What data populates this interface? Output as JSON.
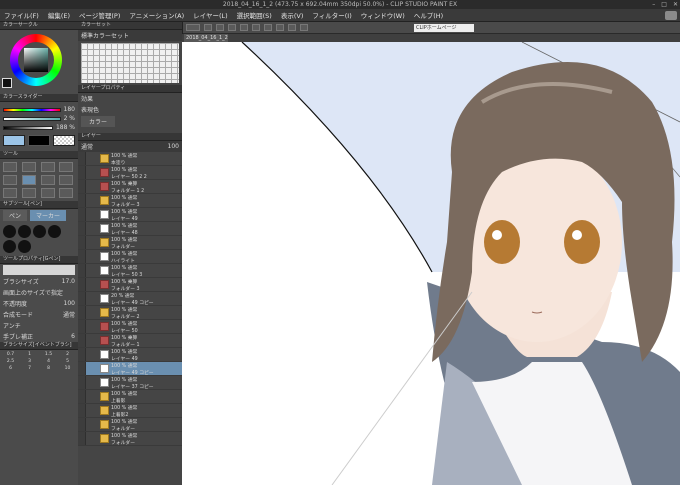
{
  "window": {
    "title": "2018_04_16_1_2 (473.75 x 692.04mm 350dpi 50.0%) - CLIP STUDIO PAINT EX"
  },
  "menu": [
    "ファイル(F)",
    "編集(E)",
    "ページ管理(P)",
    "アニメーション(A)",
    "レイヤー(L)",
    "選択範囲(S)",
    "表示(V)",
    "フィルター(I)",
    "ウィンドウ(W)",
    "ヘルプ(H)"
  ],
  "toolbar": {
    "url_label": "CLIPホームページ"
  },
  "panels": {
    "color_circle": "カラーサークル",
    "color_set": "カラーセット",
    "color_set_name": "標準カラーセット",
    "layer_property": "レイヤープロパティ",
    "effect": "効果",
    "expression_color": "表現色",
    "color_mode": "カラー",
    "color_slider": "カラースライダー",
    "slider_values": [
      "180",
      "2 %",
      "188 %"
    ],
    "tool": "ツール",
    "layer": "レイヤー",
    "layer_mode": "通常",
    "layer_opacity": "100",
    "sub_tool": "サブツール[ペン]",
    "sub_tool_tabs": [
      "ペン",
      "マーカー"
    ],
    "tool_property": "ツールプロパティ[Gペン]",
    "brush_size_label": "ブラシサイズ",
    "brush_size_value": "17.0",
    "brush_size_note": "画面上のサイズで指定",
    "opacity_label": "不透明度",
    "opacity_value": "100",
    "blend_label": "合成モード",
    "blend_value": "通常",
    "antialias_label": "アンチ",
    "stabilize_label": "手ブレ補正",
    "stabilize_value": "6",
    "brush_size_panel": "ブラシサイズ[イベントブラシ]",
    "brush_sizes": [
      "0.7",
      "1",
      "1.5",
      "2",
      "2.5",
      "3",
      "4",
      "5",
      "6",
      "7",
      "8",
      "10"
    ]
  },
  "layers": [
    {
      "name": "100 % 通常",
      "sub": "本塗り",
      "kind": "folder"
    },
    {
      "name": "100 % 通常",
      "sub": "レイヤー 50 2 2",
      "kind": "red"
    },
    {
      "name": "100 % 乗算",
      "sub": "フォルダー 1 2",
      "kind": "red"
    },
    {
      "name": "100 % 通常",
      "sub": "フォルダー 3",
      "kind": "folder"
    },
    {
      "name": "100 % 通常",
      "sub": "レイヤー 49",
      "kind": "white"
    },
    {
      "name": "100 % 通常",
      "sub": "レイヤー 48",
      "kind": "white"
    },
    {
      "name": "100 % 通常",
      "sub": "フォルダー",
      "kind": "folder"
    },
    {
      "name": "100 % 通常",
      "sub": "ハイライト",
      "kind": "white"
    },
    {
      "name": "100 % 通常",
      "sub": "レイヤー 50 3",
      "kind": "white"
    },
    {
      "name": "100 % 乗算",
      "sub": "フォルダー 3",
      "kind": "red"
    },
    {
      "name": "20 % 通常",
      "sub": "レイヤー 49 コピー",
      "kind": "white"
    },
    {
      "name": "100 % 通常",
      "sub": "フォルダー 2",
      "kind": "folder"
    },
    {
      "name": "100 % 通常",
      "sub": "レイヤー 50",
      "kind": "red"
    },
    {
      "name": "100 % 乗算",
      "sub": "フォルダー 1",
      "kind": "red"
    },
    {
      "name": "100 % 通常",
      "sub": "レイヤー 49",
      "kind": "white"
    },
    {
      "name": "100 % 通常",
      "sub": "レイヤー 49 コピー",
      "kind": "selected"
    },
    {
      "name": "100 % 通常",
      "sub": "レイヤー 37 コピー",
      "kind": "white"
    },
    {
      "name": "100 % 通常",
      "sub": "上着影",
      "kind": "folder"
    },
    {
      "name": "100 % 通常",
      "sub": "上着影2",
      "kind": "folder"
    },
    {
      "name": "100 % 通常",
      "sub": "フォルダー",
      "kind": "folder"
    },
    {
      "name": "100 % 通常",
      "sub": "フォルダー",
      "kind": "folder"
    }
  ],
  "canvas": {
    "tab": "2018_04_16_1_2"
  },
  "colors": {
    "accent": "#6a8fb0",
    "sky": "#dde6f6",
    "hair": "#7a6a5e",
    "eye": "#b67a33",
    "jacket": "#707b8c"
  }
}
